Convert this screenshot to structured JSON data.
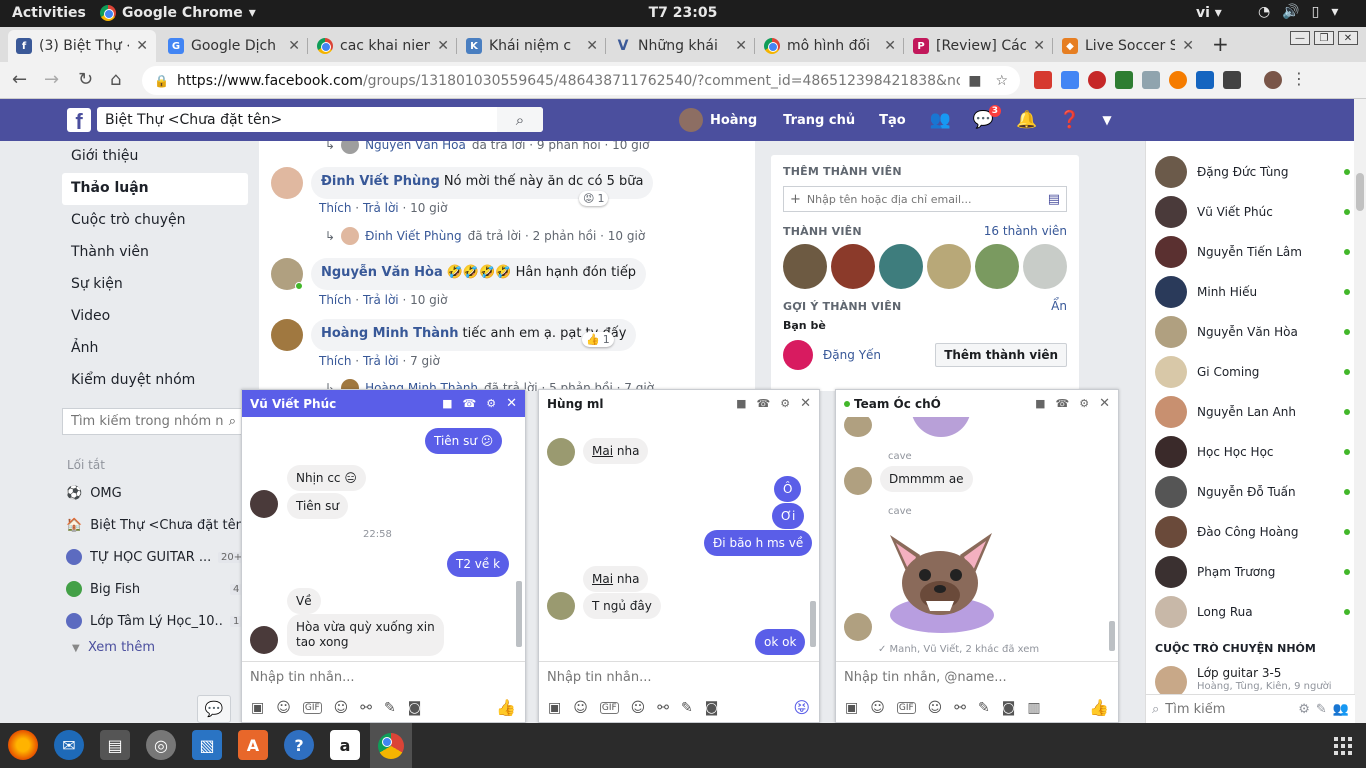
{
  "system": {
    "activities": "Activities",
    "app_name": "Google Chrome",
    "clock": "T7 23:05",
    "lang": "vi"
  },
  "tabs": [
    {
      "title": "(3) Biệt Thự <",
      "fav_color": "#3b5998",
      "fav_letter": "f"
    },
    {
      "title": "Google Dịch",
      "fav_color": "#4285f4",
      "fav_letter": "G"
    },
    {
      "title": "cac khai niem",
      "fav_color": "chrome",
      "fav_letter": ""
    },
    {
      "title": "Khái niệm c",
      "fav_color": "#4a7fc1",
      "fav_letter": "K"
    },
    {
      "title": "Những khái",
      "fav_color": "#ffffff",
      "fav_letter": "V"
    },
    {
      "title": "mô hình đối",
      "fav_color": "chrome",
      "fav_letter": ""
    },
    {
      "title": "[Review] Các",
      "fav_color": "#c2185b",
      "fav_letter": "P"
    },
    {
      "title": "Live Soccer S",
      "fav_color": "#e67e22",
      "fav_letter": ""
    }
  ],
  "address": {
    "domain": "https://www.facebook.com",
    "path": "/groups/131801030559645/486438711762540/?comment_id=486512398421838&notif_id=..."
  },
  "fb": {
    "search_value": "Biệt Thự <Chưa đặt tên>",
    "user_name": "Hoàng",
    "home": "Trang chủ",
    "create": "Tạo",
    "messenger_badge": "3"
  },
  "leftnav": {
    "items": [
      "Giới thiệu",
      "Thảo luận",
      "Cuộc trò chuyện",
      "Thành viên",
      "Sự kiện",
      "Video",
      "Ảnh",
      "Kiểm duyệt nhóm"
    ],
    "search_placeholder": "Tìm kiếm trong nhóm này",
    "shortcuts_title": "Lối tắt",
    "shortcuts": [
      {
        "name": "OMG",
        "count": ""
      },
      {
        "name": "Biệt Thự <Chưa đặt tên>",
        "count": ""
      },
      {
        "name": "TỰ HỌC GUITAR ...",
        "count": "20+"
      },
      {
        "name": "Big Fish",
        "count": "4"
      },
      {
        "name": "Lớp Tâm Lý Học_10...",
        "count": "1"
      }
    ],
    "see_more": "Xem thêm"
  },
  "feed": {
    "reply0": {
      "name": "Nguyễn Văn Hòa",
      "text": "đã trả lời · 9 phản hồi · 10 giờ"
    },
    "comments": [
      {
        "name": "Đinh Viết Phùng",
        "text": "Nó mời thế này ăn dc có 5 bữa",
        "like": "Thích",
        "reply": "Trả lời",
        "time": "10 giờ",
        "react_count": "1"
      },
      {
        "name": "Nguyễn Văn Hòa",
        "text": "🤣🤣🤣🤣 Hân hạnh đón tiếp",
        "like": "Thích",
        "reply": "Trả lời",
        "time": "10 giờ",
        "react_count": ""
      },
      {
        "name": "Hoàng Minh Thành",
        "text": "tiếc anh em ạ. pạt ty đấy",
        "like": "Thích",
        "reply": "Trả lời",
        "time": "7 giờ",
        "react_count": "1"
      }
    ],
    "reply1": {
      "name": "Đinh Viết Phùng",
      "text": "đã trả lời · 2 phản hồi · 10 giờ"
    },
    "reply3": {
      "name": "Hoàng Minh Thành",
      "text": "đã trả lời · 5 phản hồi · 7 giờ"
    }
  },
  "rightcol": {
    "add_member_title": "THÊM THÀNH VIÊN",
    "add_placeholder": "Nhập tên hoặc địa chỉ email...",
    "members_title": "THÀNH VIÊN",
    "members_count": "16 thành viên",
    "suggest_title": "GỢI Ý THÀNH VIÊN",
    "hide": "Ẩn",
    "friends": "Bạn bè",
    "suggestion_name": "Đặng Yến",
    "add_button": "Thêm thành viên"
  },
  "contacts": [
    "Đặng Đức Tùng",
    "Vũ Viết Phúc",
    "Nguyễn Tiến Lâm",
    "Minh Hiếu",
    "Nguyễn Văn Hòa",
    "Gi Coming",
    "Nguyễn Lan Anh",
    "Học Học Học",
    "Nguyễn Đỗ Tuấn",
    "Đào Công Hoàng",
    "Phạm Trương",
    "Long Rua"
  ],
  "chat_sidebar": {
    "group_heading": "CUỘC TRÒ CHUYỆN NHÓM",
    "group_item": "Lớp guitar 3-5",
    "group_sub": "Hoàng, Tùng, Kiên, 9 người",
    "search_placeholder": "Tìm kiếm"
  },
  "chat1": {
    "title": "Vũ Viết Phúc",
    "msgs": {
      "m1": "Tiên sư 😕",
      "m2": "Nhịn cc 😑",
      "m3": "Tiên sư",
      "time": "22:58",
      "m4": "T2 về k",
      "m5": "Về",
      "m6a": "Hòa vừa quỳ xuống xin",
      "m6b": "tao xong"
    },
    "placeholder": "Nhập tin nhắn..."
  },
  "chat2": {
    "title": "Hùng ml",
    "msgs": {
      "m1": "Mai",
      "m1b": " nha",
      "m2": "Ô",
      "m3": "Ơi",
      "m4": "Đi bão h ms về",
      "m5": "Mai",
      "m5b": " nha",
      "m6": "T ngủ đây",
      "m7": "ok ok"
    },
    "placeholder": "Nhập tin nhắn..."
  },
  "chat3": {
    "title": "Team Óc chÓ",
    "msgs": {
      "s1": "cave",
      "m1": "Dmmmm ae",
      "s2": "cave",
      "seen": "✓ Manh, Vũ Viết, 2 khác đã xem"
    },
    "placeholder": "Nhập tin nhắn, @name..."
  }
}
